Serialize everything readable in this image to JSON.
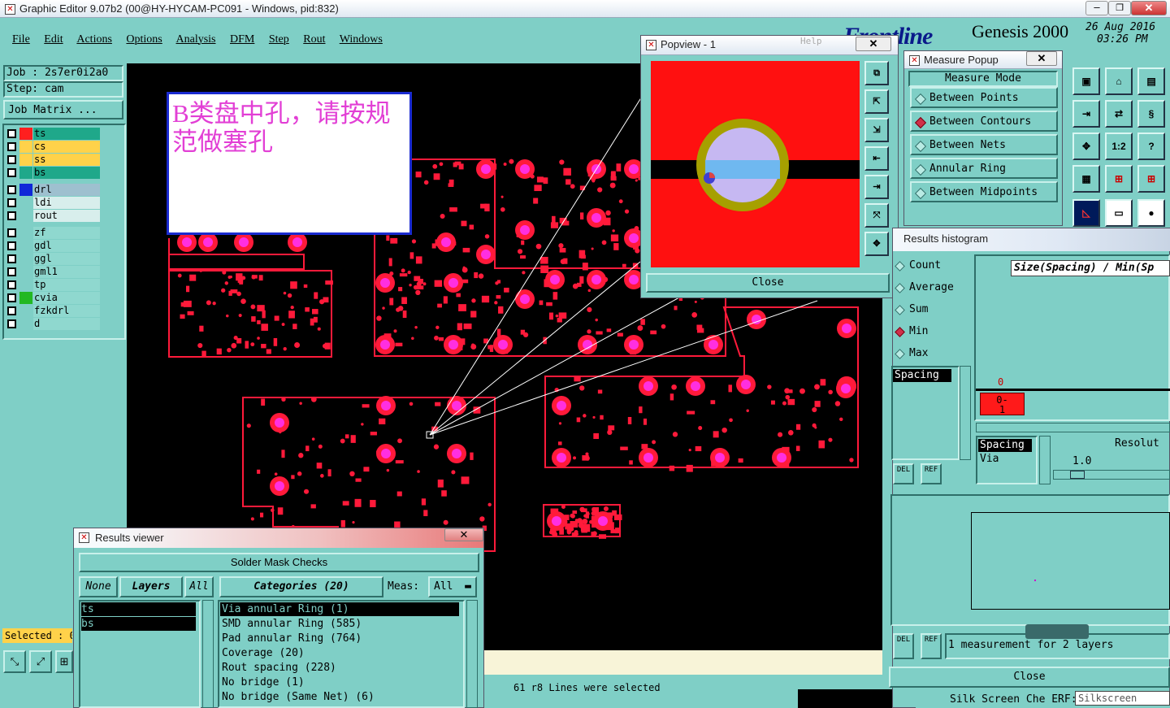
{
  "window": {
    "title": "Graphic Editor 9.07b2 (00@HY-HYCAM-PC091 - Windows, pid:832)"
  },
  "menu": [
    "File",
    "Edit",
    "Actions",
    "Options",
    "Analysis",
    "DFM",
    "Step",
    "Rout",
    "Windows"
  ],
  "brand": {
    "logo": "Frontline",
    "product": "Genesis 2000",
    "date": "26 Aug 2016",
    "time": "03:26 PM"
  },
  "job": {
    "job": "Job : 2s7er0i2a0",
    "step": "Step: cam",
    "matrix": "Job Matrix ..."
  },
  "layers": [
    {
      "name": "ts",
      "color": "#ff1f1f",
      "bg": "#1fa88a"
    },
    {
      "name": "cs",
      "color": "#ffd24a",
      "bg": "#ffd24a"
    },
    {
      "name": "ss",
      "color": "#ffd24a",
      "bg": "#ffd24a"
    },
    {
      "name": "bs",
      "color": "#1fa88a",
      "bg": "#1fa88a"
    }
  ],
  "layers2": [
    {
      "name": "drl",
      "color": "#1028d8",
      "bg": "#9ec0cf"
    },
    {
      "name": "ldi",
      "color": "#7fcfc6",
      "bg": "#d8eeec"
    },
    {
      "name": "rout",
      "color": "#7fcfc6",
      "bg": "#d8eeec"
    }
  ],
  "layers3": [
    {
      "name": "zf",
      "color": "#7fcfc6"
    },
    {
      "name": "gdl",
      "color": "#7fcfc6"
    },
    {
      "name": "ggl",
      "color": "#7fcfc6"
    },
    {
      "name": "gml1",
      "color": "#7fcfc6"
    },
    {
      "name": "tp",
      "color": "#7fcfc6"
    },
    {
      "name": "cvia",
      "color": "#22b822"
    },
    {
      "name": "fzkdrl",
      "color": "#7fcfc6"
    },
    {
      "name": "d",
      "color": "#7fcfc6"
    }
  ],
  "selected": "Selected : 0",
  "note": "B类盘中孔，请按规范做塞孔",
  "popview": {
    "title": "Popview - 1",
    "close": "Close",
    "help": "Help"
  },
  "measure": {
    "title": "Measure Popup",
    "header": "Measure Mode",
    "items": [
      "Between Points",
      "Between Contours",
      "Between Nets",
      "Annular Ring",
      "Between Midpoints"
    ],
    "selected_index": 1
  },
  "histogram": {
    "title": "Results histogram",
    "options": [
      "Count",
      "Average",
      "Sum",
      "Min",
      "Max"
    ],
    "selected_index": 3,
    "header": "Size(Spacing) / Min(Sp",
    "list": [
      "Spacing"
    ],
    "zero": "0",
    "bar_label": "0-\n1",
    "list2": [
      "Spacing",
      "Via"
    ],
    "resolution_label": "Resolut",
    "resolution": "1.0",
    "del": "DEL",
    "ref": "REF",
    "measurement_text": "1 measurement for 2 layers",
    "close": "Close"
  },
  "results_viewer": {
    "title": "Results viewer",
    "header": "Solder Mask Checks",
    "none": "None",
    "layers": "Layers",
    "all": "All",
    "categories": "Categories (20)",
    "meas_label": "Meas:",
    "meas_value": "All",
    "layer_items": [
      "ts",
      "bs"
    ],
    "category_items": [
      "Via annular Ring (1)",
      "SMD annular Ring (585)",
      "Pad annular Ring (764)",
      "Coverage (20)",
      "Rout spacing (228)",
      "No bridge (1)",
      "No bridge (Same Net) (6)"
    ]
  },
  "status": "61 r8 Lines were selected",
  "taskbar": {
    "silk": "Silk Screen Che ERF:",
    "silk2": "Silkscreen"
  }
}
